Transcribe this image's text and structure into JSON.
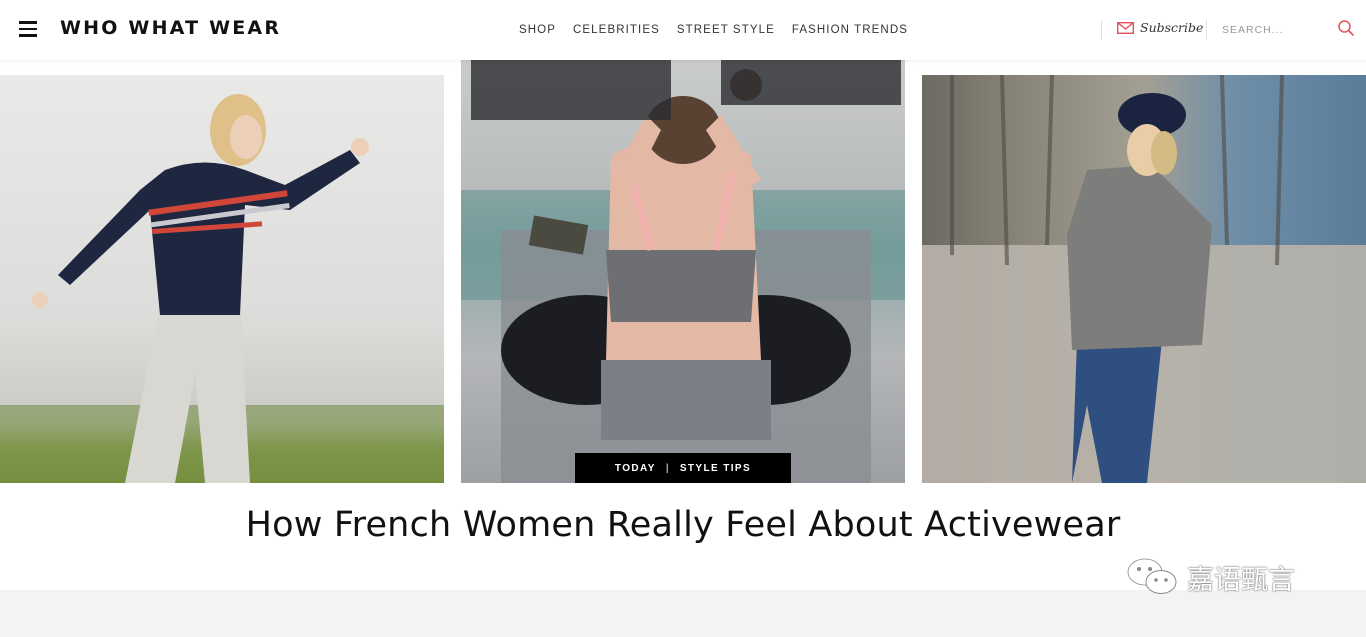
{
  "header": {
    "logo": "WHO WHAT WEAR",
    "nav": [
      "SHOP",
      "CELEBRITIES",
      "STREET STYLE",
      "FASHION TRENDS"
    ],
    "subscribe_label": "Subscribe",
    "search_placeholder": "SEARCH..."
  },
  "article": {
    "tag_left": "TODAY",
    "tag_separator": "|",
    "tag_right": "STYLE TIPS",
    "headline": "How French Women Really Feel About Activewear"
  },
  "watermark": {
    "text": "嘉语甄言"
  },
  "colors": {
    "accent": "#e4515c",
    "text": "#111111",
    "tag_background": "#000000"
  },
  "icons": [
    "menu-icon",
    "envelope-icon",
    "search-icon",
    "wechat-icon"
  ]
}
